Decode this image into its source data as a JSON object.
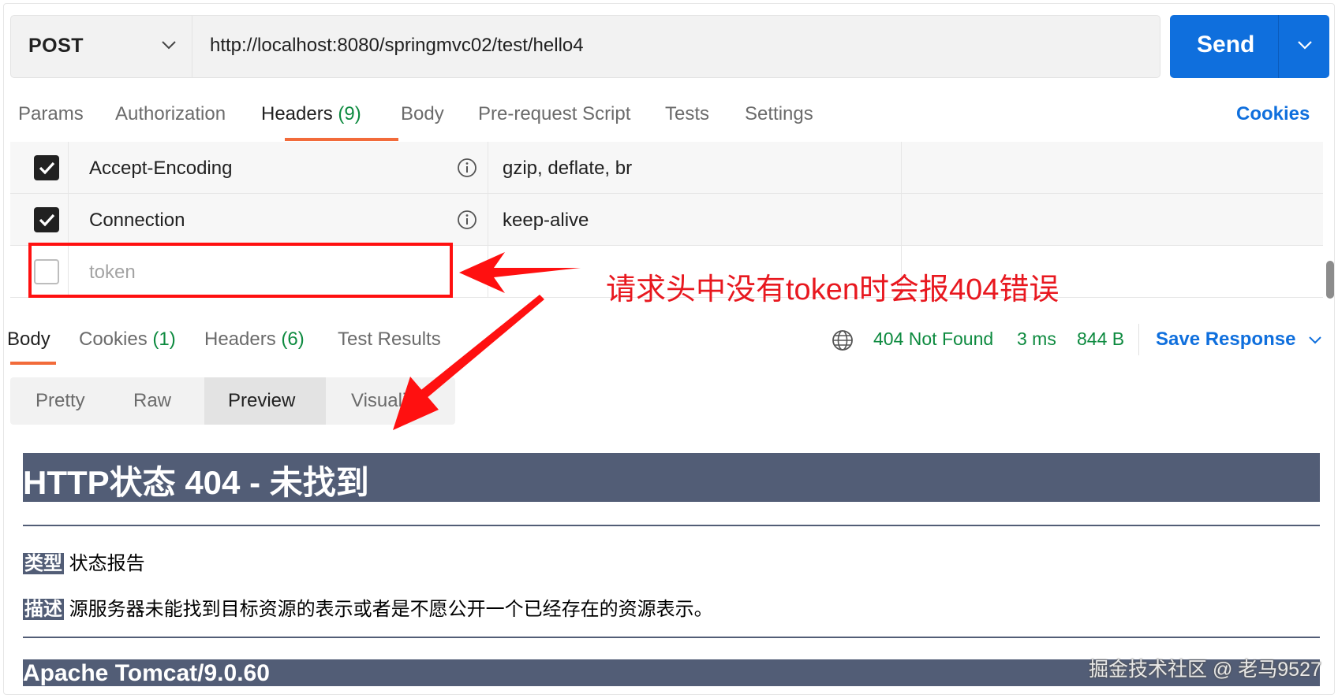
{
  "request": {
    "method": "POST",
    "url": "http://localhost:8080/springmvc02/test/hello4",
    "send_label": "Send"
  },
  "request_tabs": [
    {
      "label": "Params"
    },
    {
      "label": "Authorization"
    },
    {
      "label": "Headers",
      "count": "(9)",
      "active": true
    },
    {
      "label": "Body"
    },
    {
      "label": "Pre-request Script"
    },
    {
      "label": "Tests"
    },
    {
      "label": "Settings"
    }
  ],
  "cookies_link": "Cookies",
  "headers": [
    {
      "key": "Accept-Encoding",
      "value": "gzip, deflate, br",
      "checked": true
    },
    {
      "key": "Connection",
      "value": "keep-alive",
      "checked": true
    },
    {
      "key_placeholder": "token",
      "value": "",
      "checked": false
    }
  ],
  "annotation": "请求头中没有token时会报404错误",
  "response_tabs": [
    {
      "label": "Body",
      "active": true
    },
    {
      "label": "Cookies",
      "count": "(1)"
    },
    {
      "label": "Headers",
      "count": "(6)"
    },
    {
      "label": "Test Results"
    }
  ],
  "response_status": {
    "code_text": "404 Not Found",
    "time": "3 ms",
    "size": "844 B",
    "color": "#0d8a3f"
  },
  "save_response": "Save Response",
  "view_modes": [
    {
      "label": "Pretty"
    },
    {
      "label": "Raw"
    },
    {
      "label": "Preview",
      "active": true
    },
    {
      "label": "Visualiz"
    }
  ],
  "preview": {
    "heading": "HTTP状态 404 - 未找到",
    "type_label": "类型",
    "type_value": "状态报告",
    "desc_label": "描述",
    "desc_value": "源服务器未能找到目标资源的表示或者是不愿公开一个已经存在的资源表示。",
    "footer": "Apache Tomcat/9.0.60"
  },
  "watermark": "掘金技术社区 @ 老马9527",
  "colors": {
    "accent": "#0f6fdd",
    "tab_underline": "#f26b3a",
    "annotation_red": "#e8181f",
    "tomcat_bar": "#525d76"
  }
}
